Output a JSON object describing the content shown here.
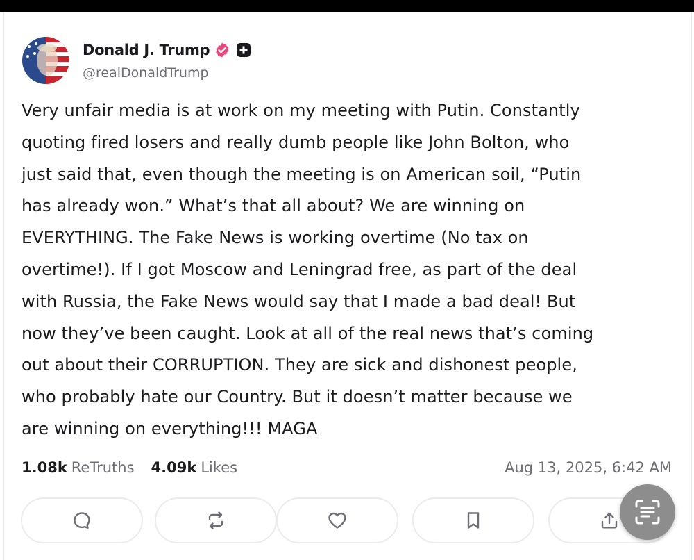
{
  "author": {
    "name": "Donald J. Trump",
    "handle": "@realDonaldTrump",
    "verified_color": "#e8477e"
  },
  "post": {
    "text": "Very unfair media is at work on my meeting with Putin. Constantly\nquoting fired losers and really dumb people like John Bolton, who\njust said that, even though the meeting is on American soil, “Putin\nhas already won.” What’s that all about? We are winning on\nEVERYTHING. The Fake News is working overtime (No tax on\novertime!). If I got Moscow and Leningrad free, as part of the deal\nwith Russia, the Fake News would say that I made a bad deal! But\nnow they’ve been caught. Look at all of the real news that’s coming\nout about their CORRUPTION. They are sick and dishonest people,\nwho probably hate our Country. But it doesn’t matter because we\nare winning on everything!!! MAGA"
  },
  "stats": {
    "retruths_count": "1.08k",
    "retruths_label": "ReTruths",
    "likes_count": "4.09k",
    "likes_label": "Likes",
    "timestamp": "Aug 13, 2025, 6:42 AM"
  },
  "actions": [
    {
      "icon": "reply-icon"
    },
    {
      "icon": "retruth-icon"
    },
    {
      "icon": "heart-icon"
    },
    {
      "icon": "bookmark-icon"
    },
    {
      "icon": "share-icon"
    }
  ],
  "overlay": {
    "icon": "text-scan-icon"
  }
}
